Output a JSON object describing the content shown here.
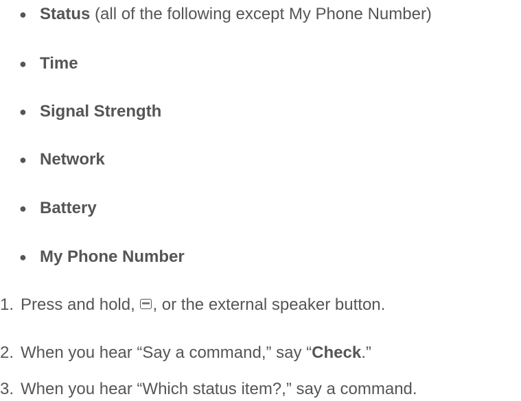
{
  "bullets": [
    {
      "bold": "Status",
      "rest": " (all of the following except My Phone Number)"
    },
    {
      "bold": "Time",
      "rest": ""
    },
    {
      "bold": "Signal Strength",
      "rest": ""
    },
    {
      "bold": "Network",
      "rest": ""
    },
    {
      "bold": "Battery",
      "rest": ""
    },
    {
      "bold": "My Phone Number",
      "rest": ""
    }
  ],
  "bullet_glyph": "●",
  "steps": [
    {
      "num": "1.",
      "before": "Press and hold, ",
      "icon": "speaker-key-icon",
      "after": ", or the external speaker button."
    },
    {
      "num": "2.",
      "before": "When you hear “Say a command,” say “",
      "bold": "Check",
      "after": ".”"
    },
    {
      "num": "3.",
      "text": "When you hear “Which status item?,” say a command."
    }
  ]
}
